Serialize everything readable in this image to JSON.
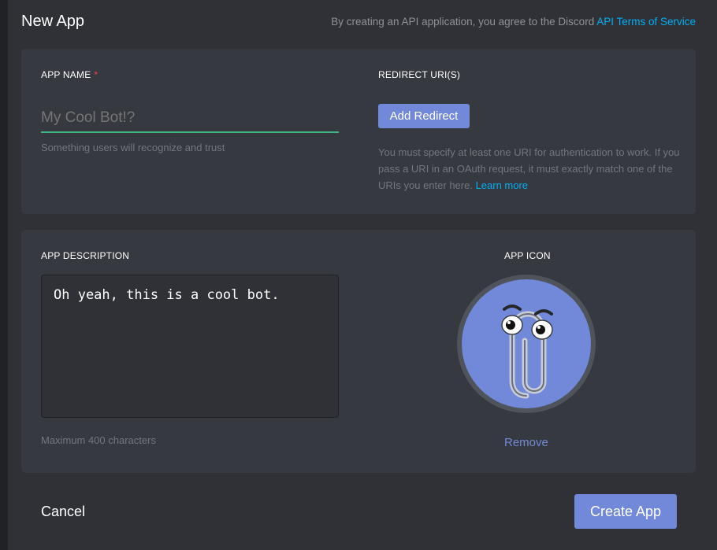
{
  "header": {
    "title": "New App",
    "terms_prefix": "By creating an API application, you agree to the Discord ",
    "terms_link": "API Terms of Service"
  },
  "app_name": {
    "label": "APP NAME",
    "required_marker": "*",
    "placeholder": "My Cool Bot!?",
    "value": "",
    "hint": "Something users will recognize and trust"
  },
  "redirect": {
    "label": "REDIRECT URI(S)",
    "add_button": "Add Redirect",
    "help_text": "You must specify at least one URI for authentication to work. If you pass a URI in an OAuth request, it must exactly match one of the URIs you enter here. ",
    "learn_more": "Learn more"
  },
  "description": {
    "label": "APP DESCRIPTION",
    "value": "Oh yeah, this is a cool bot.",
    "hint": "Maximum 400 characters"
  },
  "app_icon": {
    "label": "APP ICON",
    "icon_name": "paperclip-mascot-icon",
    "background_color": "#7289da",
    "remove_label": "Remove"
  },
  "footer": {
    "cancel_label": "Cancel",
    "create_label": "Create App"
  },
  "colors": {
    "accent": "#7289da",
    "link": "#00b0f4",
    "success": "#43b581",
    "required": "#f04747",
    "background": "#2f3136",
    "card": "#36393f"
  }
}
